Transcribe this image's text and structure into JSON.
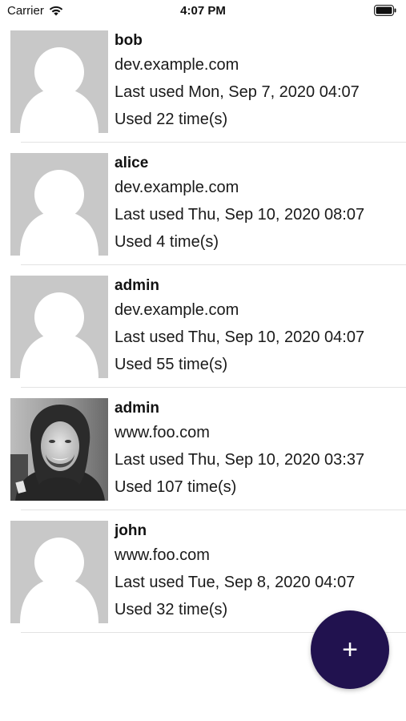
{
  "status_bar": {
    "carrier": "Carrier",
    "time": "4:07 PM"
  },
  "accounts": [
    {
      "username": "bob",
      "domain": "dev.example.com",
      "last_used": "Last used Mon, Sep 7, 2020 04:07",
      "used_count": "Used 22 time(s)",
      "avatar": "placeholder-avatar"
    },
    {
      "username": "alice",
      "domain": "dev.example.com",
      "last_used": "Last used Thu, Sep 10, 2020 08:07",
      "used_count": "Used 4 time(s)",
      "avatar": "placeholder-avatar"
    },
    {
      "username": "admin",
      "domain": "dev.example.com",
      "last_used": "Last used Thu, Sep 10, 2020 04:07",
      "used_count": "Used 55 time(s)",
      "avatar": "placeholder-avatar"
    },
    {
      "username": "admin",
      "domain": "www.foo.com",
      "last_used": "Last used Thu, Sep 10, 2020 03:37",
      "used_count": "Used 107 time(s)",
      "avatar": "photo-avatar"
    },
    {
      "username": "john",
      "domain": "www.foo.com",
      "last_used": "Last used Tue, Sep 8, 2020 04:07",
      "used_count": "Used 32 time(s)",
      "avatar": "placeholder-avatar"
    }
  ],
  "fab": {
    "label": "+",
    "color": "#21124f",
    "icon": "plus-icon"
  },
  "colors": {
    "placeholder_bg": "#c8c8c8",
    "placeholder_figure": "#ffffff"
  }
}
